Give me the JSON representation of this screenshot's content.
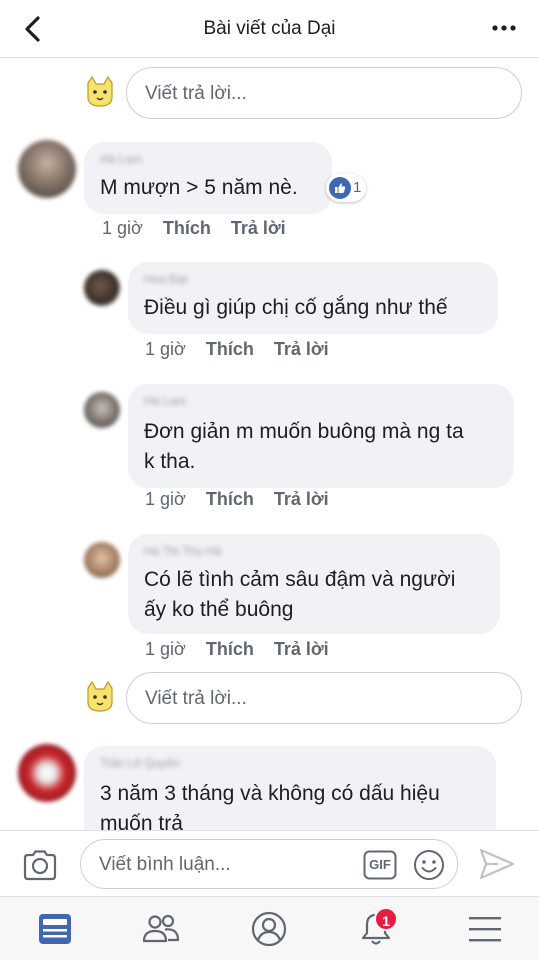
{
  "header": {
    "title": "Bài viết của Dại"
  },
  "reply_placeholder": "Viết trả lời...",
  "comments": [
    {
      "author": "Hà Lam",
      "text_lines": [
        "M mượn > 5 năm nè."
      ],
      "time": "1 giờ",
      "like_label": "Thích",
      "reply_label": "Trả lời",
      "reaction_count": "1"
    },
    {
      "author": "Hoa Đại",
      "text_lines": [
        "Điều gì giúp chị cố gắng như thế"
      ],
      "time": "1 giờ",
      "like_label": "Thích",
      "reply_label": "Trả lời"
    },
    {
      "author": "Hà Lam",
      "text_lines": [
        "Đơn giản m muốn buông mà ng ta",
        "k tha."
      ],
      "time": "1 giờ",
      "like_label": "Thích",
      "reply_label": "Trả lời"
    },
    {
      "author": "Hà Thị Thu Hà",
      "text_lines": [
        "Có lẽ tình cảm sâu đậm và người",
        "ấy ko thể buông"
      ],
      "time": "1 giờ",
      "like_label": "Thích",
      "reply_label": "Trả lời"
    },
    {
      "author": "Trần Lê Quyên",
      "text_lines": [
        "3 năm 3 tháng và không có dấu hiệu",
        "muốn trả"
      ]
    }
  ],
  "composer": {
    "placeholder": "Viết bình luận...",
    "gif_label": "GIF"
  },
  "tabbar": {
    "notification_count": "1"
  },
  "colors": {
    "accent": "#4267b2",
    "bubble": "#f0f2f5",
    "badge": "#e41e3f"
  }
}
